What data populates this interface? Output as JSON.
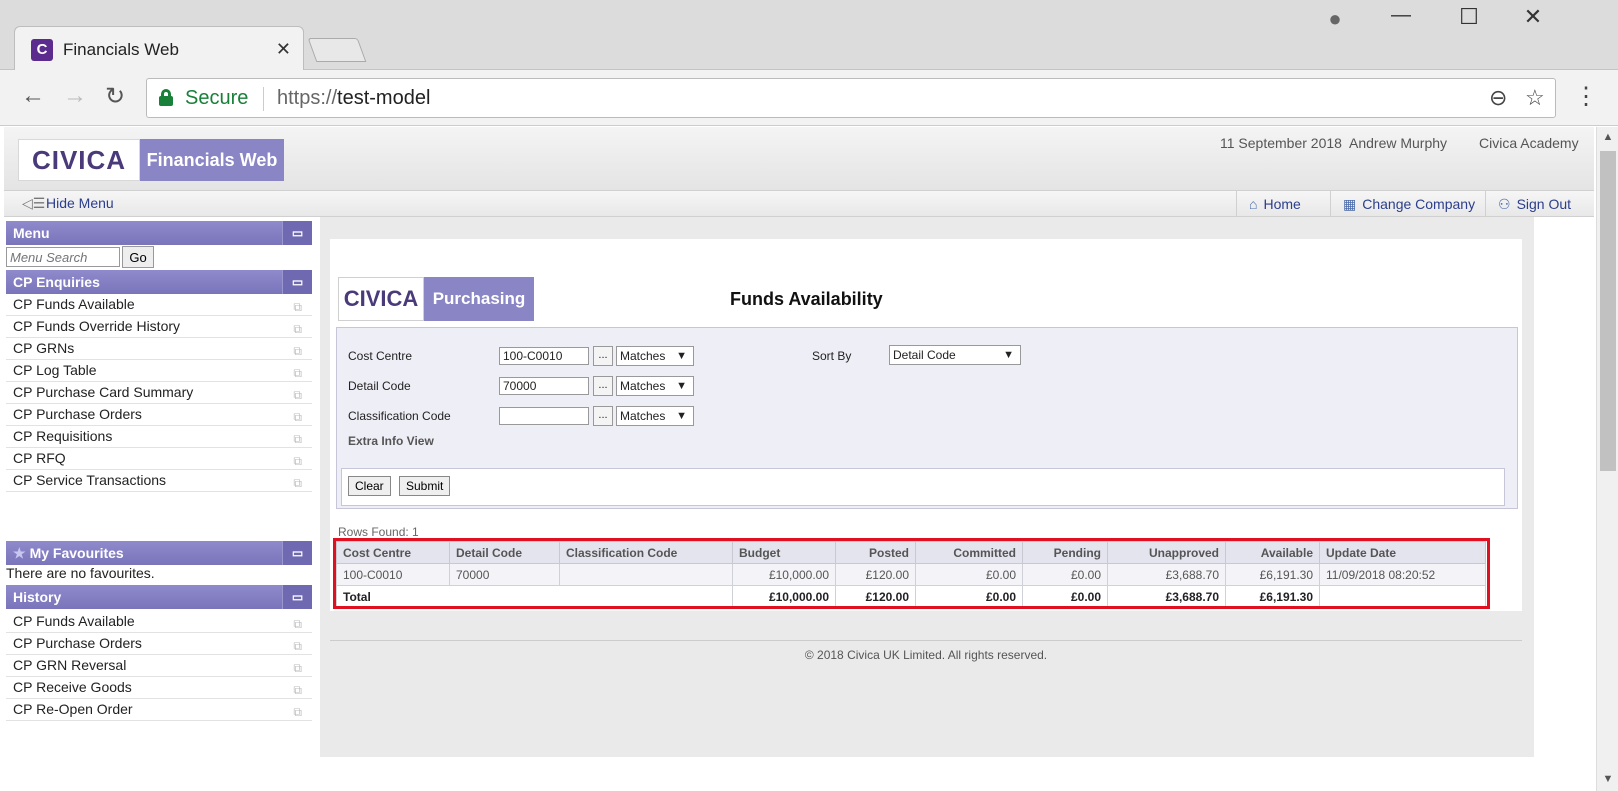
{
  "browser": {
    "tab_title": "Financials Web",
    "tab_favicon": "C",
    "secure_label": "Secure",
    "url_scheme": "https://",
    "url_host": "test-model",
    "icons": [
      "back-icon",
      "forward-icon",
      "reload-icon",
      "lock-icon",
      "zoom-icon",
      "star-icon",
      "menu-icon",
      "account-icon",
      "minimize-icon",
      "maximize-icon",
      "close-icon"
    ]
  },
  "app": {
    "logo_text": "CIVICA",
    "app_name": "Financials Web",
    "date": "11 September 2018",
    "user": "Andrew Murphy",
    "company": "Civica Academy",
    "hide_menu": "Hide Menu",
    "nav": {
      "home": "Home",
      "change_company": "Change Company",
      "sign_out": "Sign Out"
    },
    "accent_color": "#8a85c4"
  },
  "sidebar": {
    "menu_title": "Menu",
    "search_placeholder": "Menu Search",
    "go": "Go",
    "enquiries_title": "CP Enquiries",
    "enquiries": [
      "CP Funds Available",
      "CP Funds Override History",
      "CP GRNs",
      "CP Log Table",
      "CP Purchase Card Summary",
      "CP Purchase Orders",
      "CP Requisitions",
      "CP RFQ",
      "CP Service Transactions"
    ],
    "favourites_title": "My Favourites",
    "no_favourites": "There are no favourites.",
    "history_title": "History",
    "history": [
      "CP Funds Available",
      "CP Purchase Orders",
      "CP GRN Reversal",
      "CP Receive Goods",
      "CP Re-Open Order"
    ]
  },
  "page": {
    "module_logo": "CIVICA",
    "module_name": "Purchasing",
    "title": "Funds Availability",
    "filters": {
      "cost_centre_label": "Cost Centre",
      "cost_centre_value": "100-C0010",
      "cost_centre_match": "Matches",
      "detail_code_label": "Detail Code",
      "detail_code_value": "70000",
      "detail_code_match": "Matches",
      "classification_label": "Classification Code",
      "classification_value": "",
      "classification_match": "Matches",
      "sort_by_label": "Sort By",
      "sort_by_value": "Detail Code",
      "lookup": "...",
      "extra_info": "Extra Info View",
      "clear": "Clear",
      "submit": "Submit"
    },
    "rows_found": "Rows Found: 1",
    "table": {
      "headers": [
        "Cost Centre",
        "Detail Code",
        "Classification Code",
        "Budget",
        "Posted",
        "Committed",
        "Pending",
        "Unapproved",
        "Available",
        "Update Date"
      ],
      "row": [
        "100-C0010",
        "70000",
        "",
        "£10,000.00",
        "£120.00",
        "£0.00",
        "£0.00",
        "£3,688.70",
        "£6,191.30",
        "11/09/2018 08:20:52"
      ],
      "total_label": "Total",
      "total": [
        "£10,000.00",
        "£120.00",
        "£0.00",
        "£0.00",
        "£3,688.70",
        "£6,191.30",
        ""
      ]
    },
    "footer": "© 2018 Civica UK Limited. All rights reserved."
  }
}
